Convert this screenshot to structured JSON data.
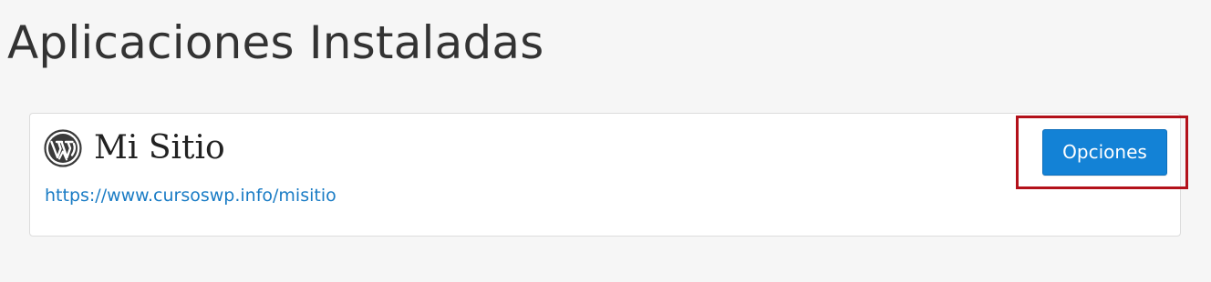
{
  "page": {
    "title": "Aplicaciones Instaladas"
  },
  "app": {
    "icon": "wordpress-icon",
    "name": "Mi Sitio",
    "url": "https://www.cursoswp.info/misitio",
    "options_label": "Opciones"
  },
  "colors": {
    "link": "#1a7cc5",
    "button": "#1382d6",
    "highlight": "#b3111a",
    "background": "#f6f6f6"
  }
}
